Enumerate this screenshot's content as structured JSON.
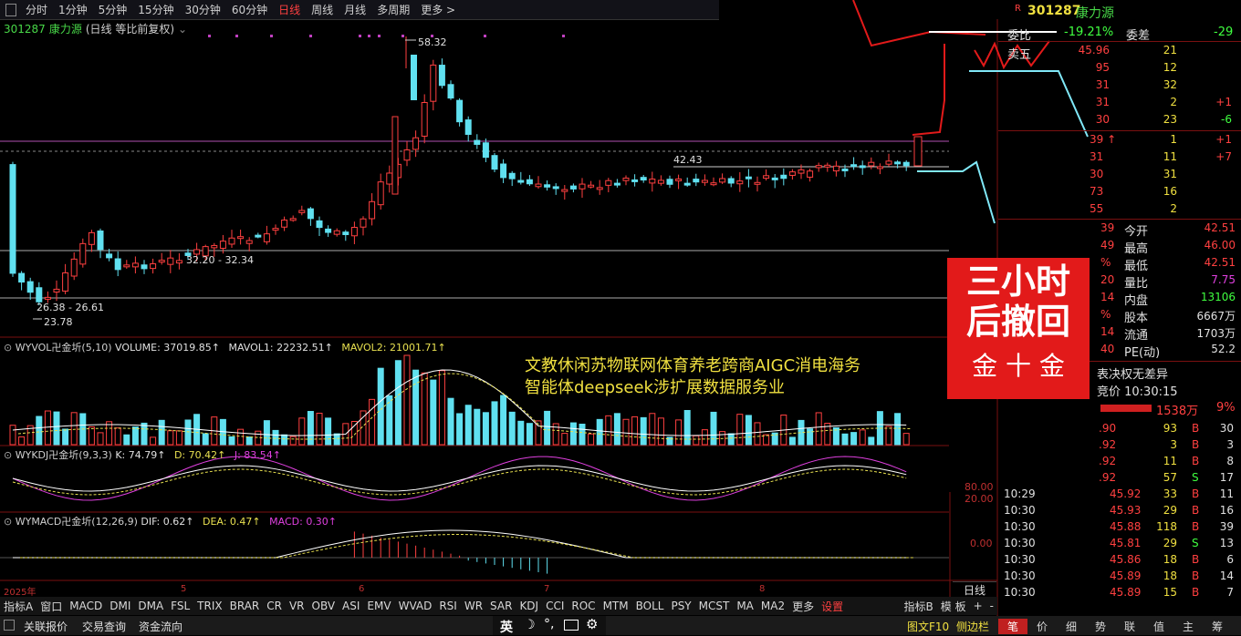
{
  "toolbar": {
    "periods": [
      "分时",
      "1分钟",
      "5分钟",
      "15分钟",
      "30分钟",
      "60分钟",
      "日线",
      "周线",
      "月线",
      "多周期",
      "更多 >"
    ],
    "active": "日线"
  },
  "stock": {
    "code": "301287",
    "name": "康力源",
    "mode": "(日线 等比前复权)"
  },
  "chart": {
    "high_label": "58.32",
    "low_label": "23.78",
    "box1": "26.38 - 26.61",
    "box2": "32.20 - 32.34",
    "level": "42.43",
    "date_labels": [
      "2025年",
      "5",
      "6",
      "7",
      "8"
    ]
  },
  "volume_title": {
    "name": "WYVOL卍金圻(5,10)",
    "v1": "VOLUME: 37019.85↑",
    "v2": "MAVOL1: 22232.51↑",
    "v3": "MAVOL2: 21001.71↑"
  },
  "kdj_title": {
    "name": "WYKDJ卍金圻(9,3,3)",
    "k": "K: 74.79↑",
    "d": "D: 70.42↑",
    "j": "J: 83.54↑"
  },
  "macd_title": {
    "name": "WYMACD卍金圻(12,26,9)",
    "dif": "DIF: 0.62↑",
    "dea": "DEA: 0.47↑",
    "macd": "MACD: 0.30↑"
  },
  "axis": {
    "kdj_top": "80.00",
    "kdj_bot": "20.00",
    "macd": "0.00"
  },
  "overlay_text": {
    "line1": "文教休闲苏物联网体育养老跨商AIGC消电海务",
    "line2": "智能体deepseek涉扩展数据服务业"
  },
  "stamp": {
    "l1": "三小时",
    "l2": "后撤回",
    "sig": "金 十 金"
  },
  "panel_header": {
    "r": "R",
    "code": "301287",
    "name": "康力源",
    "weibi": "委比",
    "weibi_val": "-19.21%",
    "weicha": "委差",
    "weicha_val": "-29",
    "weiwu": "卖五"
  },
  "sell_rows": [
    {
      "p": "45.96",
      "v": "21",
      "c": ""
    },
    {
      "p": "95",
      "v": "12",
      "c": ""
    },
    {
      "p": "31",
      "v": "32",
      "c": ""
    },
    {
      "p": "31",
      "v": "2",
      "c": "+1"
    },
    {
      "p": "30",
      "v": "23",
      "c": "-6"
    }
  ],
  "buy_rows": [
    {
      "p": "39 ↑",
      "v": "1",
      "c": "+1"
    },
    {
      "p": "31",
      "v": "11",
      "c": "+7"
    },
    {
      "p": "30",
      "v": "31",
      "c": ""
    },
    {
      "p": "73",
      "v": "16",
      "c": ""
    },
    {
      "p": "55",
      "v": "2",
      "c": ""
    }
  ],
  "stats": [
    {
      "l": "39",
      "k": "今开",
      "v": "42.51",
      "vc": "#ff4040"
    },
    {
      "l": "49",
      "k": "最高",
      "v": "46.00",
      "vc": "#ff4040"
    },
    {
      "l": "%",
      "k": "最低",
      "v": "42.51",
      "vc": "#ff4040"
    },
    {
      "l": "20",
      "k": "量比",
      "v": "7.75",
      "vc": "#e040e0"
    },
    {
      "l": "14",
      "k": "内盘",
      "v": "13106",
      "vc": "#40ff40"
    },
    {
      "l": "%",
      "k": "股本",
      "v": "6667万",
      "vc": "#e0e0e0"
    },
    {
      "l": "14",
      "k": "流通",
      "v": "1703万",
      "vc": "#e0e0e0"
    },
    {
      "l": "40",
      "k": "PE(动)",
      "v": "52.2",
      "vc": "#e0e0e0"
    }
  ],
  "note1": "表决权无差异",
  "note2": "竞价 10:30:15",
  "auction": {
    "amt": "1538万",
    "pct": "9%"
  },
  "ticks_top": [
    {
      "p": ".90",
      "v": "93",
      "s": "B",
      "n": "30"
    },
    {
      "p": ".92",
      "v": "3",
      "s": "B",
      "n": "3"
    },
    {
      "p": ".92",
      "v": "11",
      "s": "B",
      "n": "8"
    },
    {
      "p": ".92",
      "v": "57",
      "s": "S",
      "n": "17"
    }
  ],
  "ticks": [
    {
      "t": "10:29",
      "p": "45.92",
      "v": "33",
      "s": "B",
      "n": "11"
    },
    {
      "t": "10:30",
      "p": "45.93",
      "v": "29",
      "s": "B",
      "n": "16"
    },
    {
      "t": "10:30",
      "p": "45.88",
      "v": "118",
      "s": "B",
      "n": "39"
    },
    {
      "t": "10:30",
      "p": "45.81",
      "v": "29",
      "s": "S",
      "n": "13"
    },
    {
      "t": "10:30",
      "p": "45.86",
      "v": "18",
      "s": "B",
      "n": "6"
    },
    {
      "t": "10:30",
      "p": "45.89",
      "v": "18",
      "s": "B",
      "n": "14"
    },
    {
      "t": "10:30",
      "p": "45.89",
      "v": "15",
      "s": "B",
      "n": "7"
    }
  ],
  "indicator_tabs": [
    "指标A",
    "窗口",
    "MACD",
    "DMI",
    "DMA",
    "FSL",
    "TRIX",
    "BRAR",
    "CR",
    "VR",
    "OBV",
    "ASI",
    "EMV",
    "WVAD",
    "RSI",
    "WR",
    "SAR",
    "KDJ",
    "CCI",
    "ROC",
    "MTM",
    "BOLL",
    "PSY",
    "MCST",
    "MA",
    "MA2",
    "更多",
    "设置"
  ],
  "indicator_right": [
    "指标B",
    "模 板",
    "+",
    "-"
  ],
  "period_label": "日线",
  "status": {
    "items": [
      "关联报价",
      "交易查询",
      "资金流向"
    ],
    "ime": "英",
    "f10": "图文F10",
    "side": "侧边栏"
  },
  "right_tabs": [
    "笔",
    "价",
    "细",
    "势",
    "联",
    "值",
    "主",
    "筹"
  ]
}
